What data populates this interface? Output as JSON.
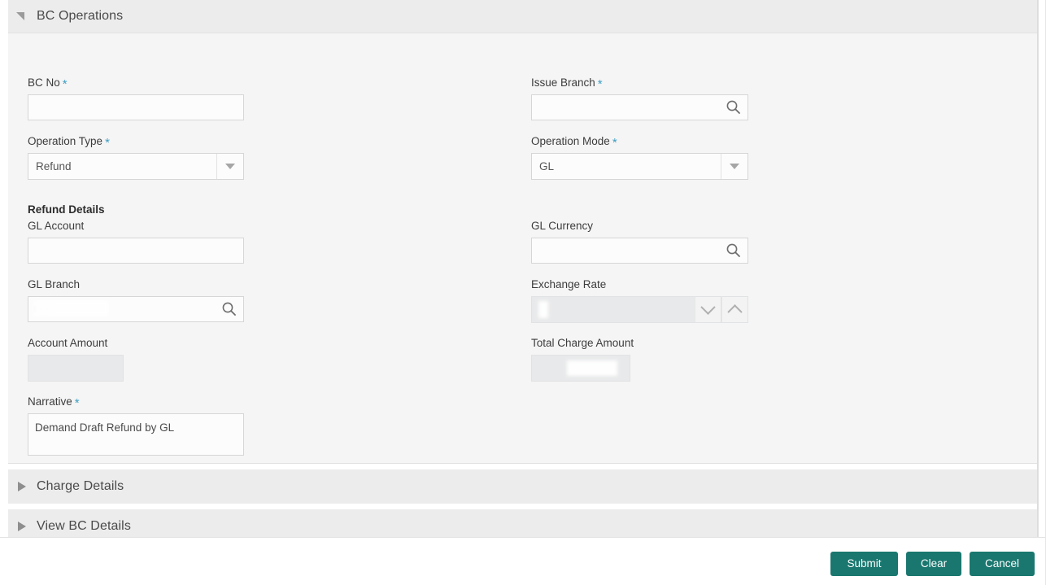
{
  "panel": {
    "title": "BC Operations",
    "expanded": true,
    "collapse_icon": "triangle-down-icon"
  },
  "form": {
    "bc_no": {
      "label": "BC No",
      "required": true,
      "value": "",
      "placeholder": ""
    },
    "issue_branch": {
      "label": "Issue Branch",
      "required": true,
      "value": "",
      "placeholder": "",
      "icon": "search-icon"
    },
    "operation_type": {
      "label": "Operation Type",
      "required": true,
      "value": "Refund",
      "icon": "chevron-down-icon"
    },
    "operation_mode": {
      "label": "Operation Mode",
      "required": true,
      "value": "GL",
      "icon": "chevron-down-icon"
    },
    "section_refund_details": {
      "label": "Refund Details"
    },
    "gl_account": {
      "label": "GL Account",
      "required": false,
      "value": "",
      "placeholder": ""
    },
    "gl_currency": {
      "label": "GL Currency",
      "required": false,
      "value": "",
      "placeholder": "",
      "icon": "search-icon"
    },
    "gl_branch": {
      "label": "GL Branch",
      "required": false,
      "value": "",
      "placeholder": "",
      "redacted": true,
      "icon": "search-icon"
    },
    "exchange_rate": {
      "label": "Exchange Rate",
      "required": false,
      "value": "",
      "disabled": true,
      "icon_down": "chevron-down-icon",
      "icon_up": "chevron-up-icon"
    },
    "account_amount": {
      "label": "Account Amount",
      "required": false,
      "value": "",
      "disabled": true
    },
    "total_charge_amount": {
      "label": "Total Charge Amount",
      "required": false,
      "value": "",
      "disabled": true,
      "redacted": true
    },
    "narrative": {
      "label": "Narrative",
      "required": true,
      "value": "Demand Draft Refund by GL",
      "placeholder": ""
    }
  },
  "sections": [
    {
      "label": "Charge Details",
      "expanded": false,
      "icon": "triangle-right-icon"
    },
    {
      "label": "View BC Details",
      "expanded": false,
      "icon": "triangle-right-icon"
    }
  ],
  "footer": {
    "submit_label": "Submit",
    "clear_label": "Clear",
    "cancel_label": "Cancel"
  },
  "colors": {
    "accent": "#19776f",
    "required_marker": "#3f9fc4",
    "panel_header_bg": "#ececec",
    "panel_body_bg": "#f5f5f5"
  }
}
